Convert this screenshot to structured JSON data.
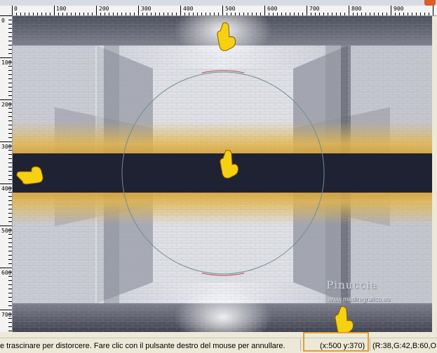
{
  "rulers": {
    "horizontal_ticks": [
      "0",
      "100",
      "200",
      "300",
      "400",
      "500",
      "600",
      "700",
      "800",
      "900"
    ],
    "vertical_ticks": [
      "0",
      "100",
      "200",
      "300",
      "400",
      "500",
      "600",
      "700"
    ]
  },
  "canvas": {
    "watermark_name": "Pinuccia",
    "watermark_url": "www.madiregrafico.eu",
    "band_color": "#1e2233",
    "accent_color": "#e0b040",
    "pointer_icons": [
      "hand-pointer-down-icon",
      "hand-pointer-down-icon",
      "hand-pointer-left-icon",
      "hand-pointer-down-icon"
    ]
  },
  "status": {
    "message": "e trascinare per distorcere. Fare clic con il pulsante destro del mouse per annullare.",
    "coords": "(x:500 y:370)",
    "color": "(R:38,G:42,B:60,O"
  }
}
